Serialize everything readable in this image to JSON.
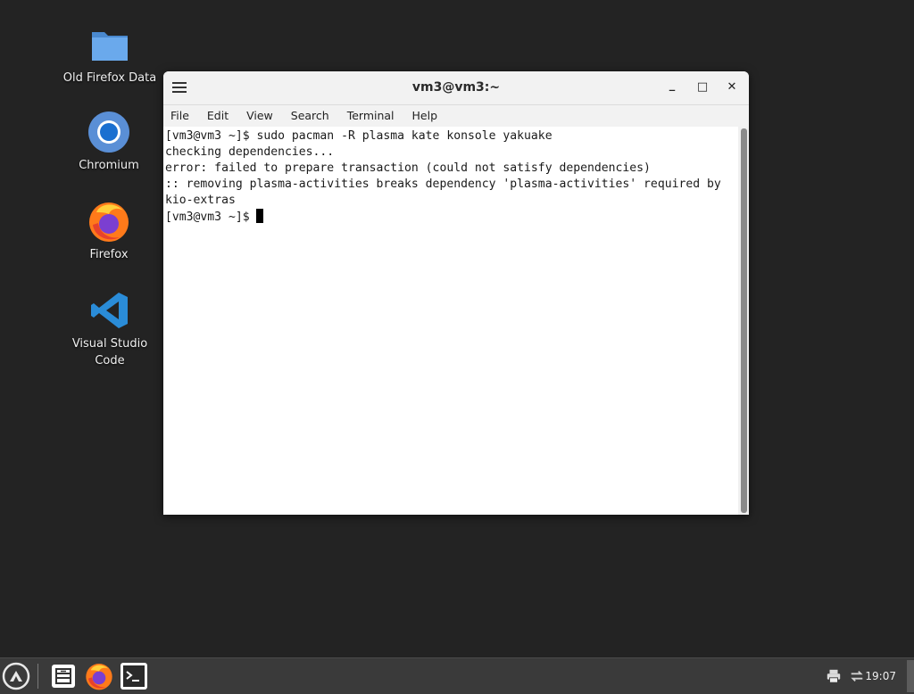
{
  "desktop": {
    "icons": [
      {
        "label": "Old Firefox Data",
        "icon": "folder-icon"
      },
      {
        "label": "Chromium",
        "icon": "chromium-icon"
      },
      {
        "label": "Firefox",
        "icon": "firefox-icon"
      },
      {
        "label": "Visual Studio Code",
        "label_line1": "Visual Studio",
        "label_line2": "Code",
        "icon": "vscode-icon"
      }
    ]
  },
  "window": {
    "title": "vm3@vm3:~",
    "controls": {
      "minimize": "_",
      "maximize": "□",
      "close": "✕"
    },
    "menu": [
      "File",
      "Edit",
      "View",
      "Search",
      "Terminal",
      "Help"
    ],
    "terminal": {
      "lines": [
        "[vm3@vm3 ~]$ sudo pacman -R plasma kate konsole yakuake",
        "checking dependencies...",
        "error: failed to prepare transaction (could not satisfy dependencies)",
        ":: removing plasma-activities breaks dependency 'plasma-activities' required by",
        "kio-extras"
      ],
      "prompt": "[vm3@vm3 ~]$ "
    }
  },
  "taskbar": {
    "clock": "19:07",
    "items": [
      "menu-launcher-icon",
      "file-manager-icon",
      "firefox-icon",
      "terminal-icon"
    ],
    "tray": [
      "printer-icon",
      "network-icon"
    ]
  },
  "colors": {
    "desktop_bg": "#232323",
    "taskbar_bg": "#3a3a3a",
    "folder_blue": "#5b9bdf",
    "vscode_blue": "#2a8cd8"
  }
}
